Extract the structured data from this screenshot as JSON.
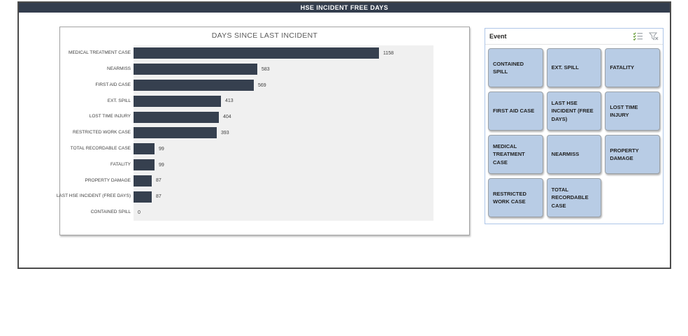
{
  "header": {
    "title": "HSE INCIDENT FREE DAYS"
  },
  "chart_data": {
    "type": "bar",
    "orientation": "horizontal",
    "title": "DAYS SINCE LAST INCIDENT",
    "categories": [
      "MEDICAL TREATMENT CASE",
      "NEARMISS",
      "FIRST AID CASE",
      "EXT. SPILL",
      "LOST TIME INJURY",
      "RESTRICTED WORK CASE",
      "TOTAL RECORDABLE CASE",
      "FATALITY",
      "PROPERTY DAMAGE",
      "LAST HSE INCIDENT (FREE DAYS)",
      "CONTAINED SPILL"
    ],
    "values": [
      1158,
      583,
      569,
      413,
      404,
      393,
      99,
      99,
      87,
      87,
      0
    ],
    "xlabel": "",
    "ylabel": "",
    "xlim": [
      0,
      1410
    ],
    "grid": false,
    "legend": "none",
    "data_labels": true,
    "bar_color": "#36404F",
    "plot_background": "#F0F0F0"
  },
  "slicer": {
    "title": "Event",
    "icons": {
      "select_all": "select-all-icon",
      "clear_filter": "clear-filter-icon"
    },
    "items": [
      "CONTAINED SPILL",
      "EXT. SPILL",
      "FATALITY",
      "FIRST AID CASE",
      "LAST HSE INCIDENT (FREE DAYS)",
      "LOST TIME INJURY",
      "MEDICAL TREATMENT CASE",
      "NEARMISS",
      "PROPERTY DAMAGE",
      "RESTRICTED WORK CASE",
      "TOTAL RECORDABLE CASE"
    ]
  },
  "colors": {
    "header_bar": "#333D4D",
    "bar": "#36404F",
    "plot_bg": "#F0F0F0",
    "slicer_button_bg": "#B8CCE5",
    "slicer_border": "#AEC6E8"
  }
}
